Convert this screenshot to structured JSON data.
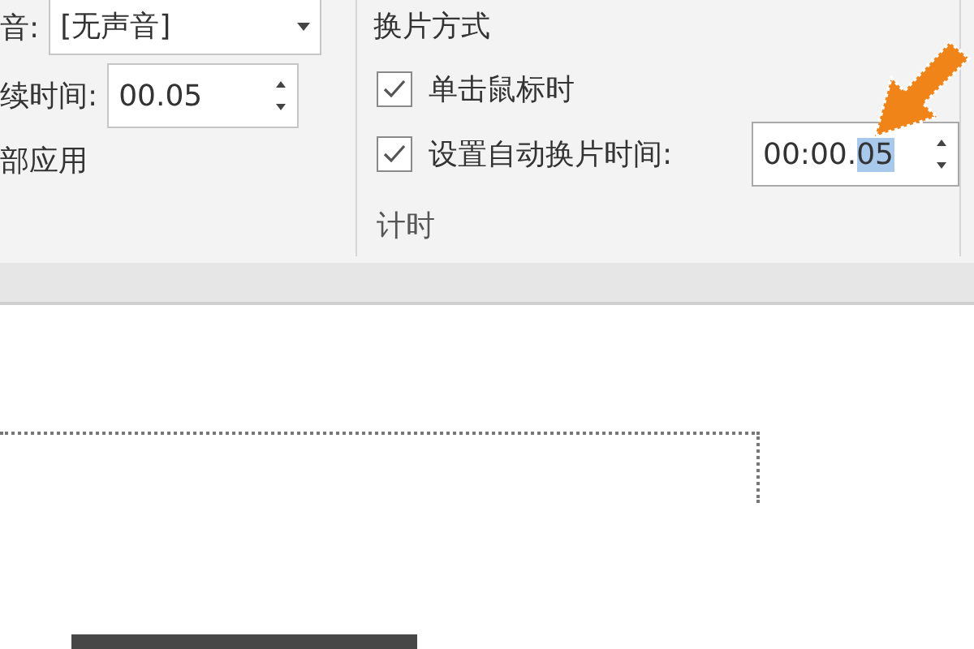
{
  "transition_group": {
    "sound_label": "音:",
    "sound_value": "[无声音]",
    "duration_label": "续时间:",
    "duration_value": "00.05",
    "apply_all": "部应用"
  },
  "timing_group": {
    "heading": "换片方式",
    "options": [
      {
        "label": "单击鼠标时",
        "checked": true
      },
      {
        "label": "设置自动换片时间:",
        "checked": true
      }
    ],
    "auto_time_parts": [
      {
        "text": "00:00.",
        "selected": false
      },
      {
        "text": "05",
        "selected": true
      }
    ],
    "group_label": "计时"
  }
}
